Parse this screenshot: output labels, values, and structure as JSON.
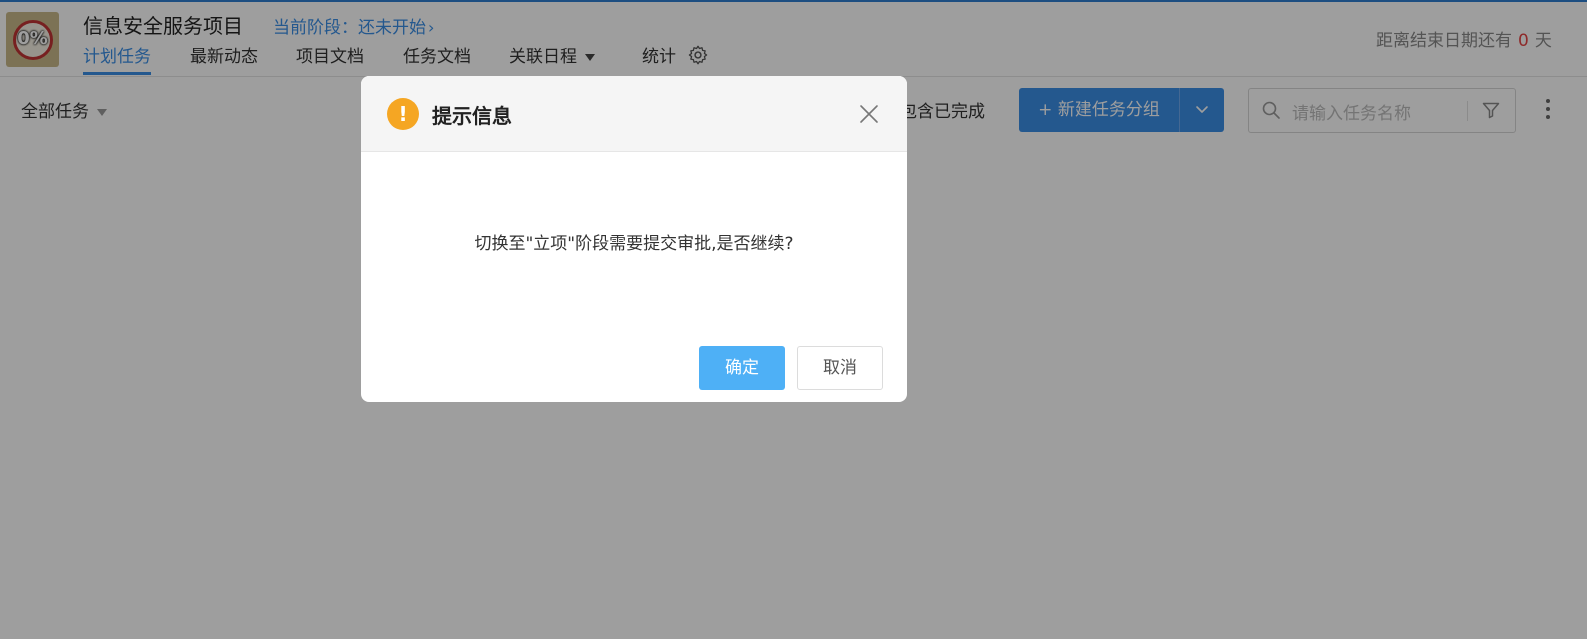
{
  "project": {
    "progress_badge": "0%",
    "title": "信息安全服务项目",
    "stage_text": "当前阶段：还未开始",
    "stage_chevron": "›"
  },
  "tabs": [
    {
      "label": "计划任务",
      "active": true
    },
    {
      "label": "最新动态"
    },
    {
      "label": "项目文档"
    },
    {
      "label": "任务文档"
    },
    {
      "label": "关联日程"
    },
    {
      "label": "统计"
    }
  ],
  "deadline": {
    "prefix": "距离结束日期还有",
    "days": "0",
    "unit": "天"
  },
  "toolbar": {
    "filter_label": "全部任务",
    "include_completed": "包含已完成",
    "new_group_button": "+ 新建任务分组",
    "search_placeholder": "请输入任务名称"
  },
  "dialog": {
    "title": "提示信息",
    "warning_glyph": "!",
    "message": "切换至\"立项\"阶段需要提交审批,是否继续?",
    "ok_label": "确定",
    "cancel_label": "取消"
  },
  "colors": {
    "accent": "#3a8ee6",
    "danger": "#e54545",
    "warning": "#f5a623",
    "ok_button": "#4eb0f6"
  }
}
